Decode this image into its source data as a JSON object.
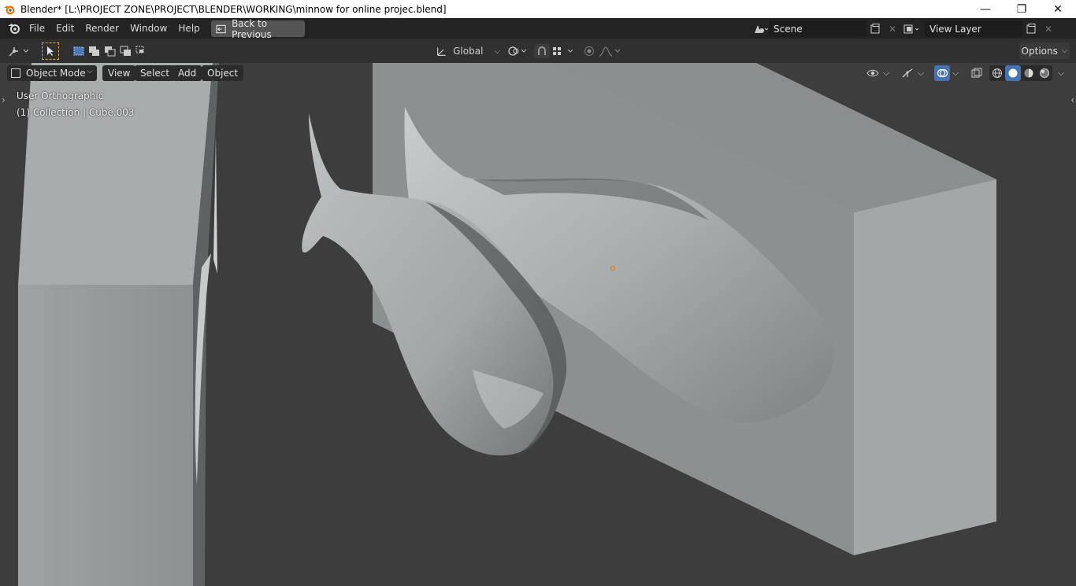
{
  "window": {
    "title": "Blender* [L:\\PROJECT ZONE\\PROJECT\\BLENDER\\WORKING\\minnow for online projec.blend]",
    "minimize": "—",
    "maximize": "❐",
    "close": "✕"
  },
  "menu": {
    "items": [
      "File",
      "Edit",
      "Render",
      "Window",
      "Help"
    ],
    "back_label": "Back to Previous"
  },
  "scene": {
    "scene_name": "Scene",
    "view_layer": "View Layer"
  },
  "toolbar": {
    "orientation": "Global",
    "options_label": "Options"
  },
  "viewport": {
    "mode": "Object Mode",
    "menus": [
      "View",
      "Select",
      "Add",
      "Object"
    ],
    "view_name": "User Orthographic",
    "collection_info": "(1) Collection | Cube.003"
  },
  "colors": {
    "background": "#3d3d3d",
    "header": "#303030",
    "topbar": "#232323",
    "mesh_light": "#aeb1b1",
    "mesh_mid": "#8e9292",
    "origin": "#e07a1f"
  }
}
